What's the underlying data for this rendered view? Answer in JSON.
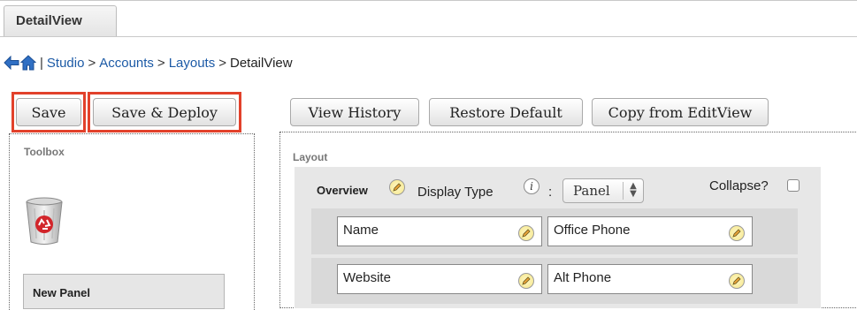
{
  "tab": {
    "label": "DetailView"
  },
  "breadcrumb": {
    "studio": "Studio",
    "accounts": "Accounts",
    "layouts": "Layouts",
    "current": "DetailView",
    "pipe": "|",
    "sep": ">"
  },
  "toolbar": {
    "save": "Save",
    "save_deploy": "Save & Deploy",
    "view_history": "View History",
    "restore_default": "Restore Default",
    "copy_from_editview": "Copy from EditView"
  },
  "toolbox": {
    "title": "Toolbox",
    "new_panel": "New Panel"
  },
  "layout": {
    "title": "Layout",
    "panel_name": "Overview",
    "display_type_label": "Display Type",
    "colon": ":",
    "display_type_value": "Panel",
    "collapse_label": "Collapse?",
    "rows": [
      {
        "left": "Name",
        "right": "Office Phone"
      },
      {
        "left": "Website",
        "right": "Alt Phone"
      }
    ]
  },
  "colors": {
    "highlight": "#e2412b",
    "link": "#1c5aa6",
    "trash_recycle": "#d2262b"
  },
  "icons": {
    "back": "back-arrow-icon",
    "home": "home-icon",
    "trash": "recycle-bin-icon",
    "edit": "pencil-icon",
    "info": "info-icon"
  }
}
